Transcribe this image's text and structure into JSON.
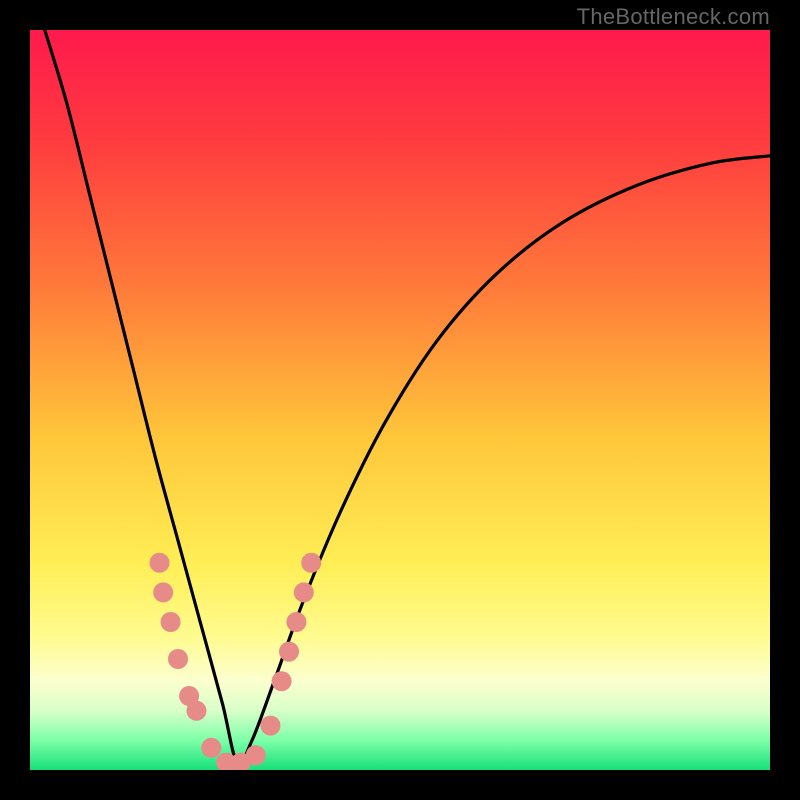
{
  "watermark": "TheBottleneck.com",
  "chart_data": {
    "type": "line",
    "title": "",
    "xlabel": "",
    "ylabel": "",
    "xlim": [
      0,
      100
    ],
    "ylim": [
      0,
      100
    ],
    "description": "V-shaped bottleneck curve over a vertical gradient from red (top, high bottleneck) through orange and yellow to green (bottom, optimal). Minimum of the curve sits near x≈28 at y≈0. Salmon dots mark sample points along the lower limbs of the curve.",
    "gradient_stops": [
      {
        "pos": 0.0,
        "color": "#ff1a4d"
      },
      {
        "pos": 0.15,
        "color": "#ff3b3f"
      },
      {
        "pos": 0.35,
        "color": "#ff7b3a"
      },
      {
        "pos": 0.55,
        "color": "#ffc63a"
      },
      {
        "pos": 0.72,
        "color": "#ffee55"
      },
      {
        "pos": 0.82,
        "color": "#fffb8f"
      },
      {
        "pos": 0.88,
        "color": "#fcffcf"
      },
      {
        "pos": 0.92,
        "color": "#d8ffc8"
      },
      {
        "pos": 0.96,
        "color": "#7dffa8"
      },
      {
        "pos": 1.0,
        "color": "#16e07a"
      }
    ],
    "series": [
      {
        "name": "bottleneck-curve",
        "x": [
          2,
          5,
          8,
          11,
          14,
          17,
          20,
          23,
          26,
          28,
          30,
          33,
          37,
          42,
          48,
          55,
          63,
          72,
          82,
          92,
          100
        ],
        "y": [
          100,
          90,
          78,
          66,
          54,
          42,
          31,
          20,
          9,
          1,
          4,
          12,
          23,
          35,
          47,
          58,
          67,
          74,
          79,
          82,
          83
        ]
      }
    ],
    "dots": {
      "color": "#e68b87",
      "radius": 10,
      "points": [
        {
          "x": 17.5,
          "y": 28
        },
        {
          "x": 18.0,
          "y": 24
        },
        {
          "x": 19.0,
          "y": 20
        },
        {
          "x": 20.0,
          "y": 15
        },
        {
          "x": 21.5,
          "y": 10
        },
        {
          "x": 22.5,
          "y": 8
        },
        {
          "x": 24.5,
          "y": 3
        },
        {
          "x": 26.5,
          "y": 1
        },
        {
          "x": 28.5,
          "y": 1
        },
        {
          "x": 30.5,
          "y": 2
        },
        {
          "x": 32.5,
          "y": 6
        },
        {
          "x": 34.0,
          "y": 12
        },
        {
          "x": 35.0,
          "y": 16
        },
        {
          "x": 36.0,
          "y": 20
        },
        {
          "x": 37.0,
          "y": 24
        },
        {
          "x": 38.0,
          "y": 28
        }
      ]
    }
  }
}
